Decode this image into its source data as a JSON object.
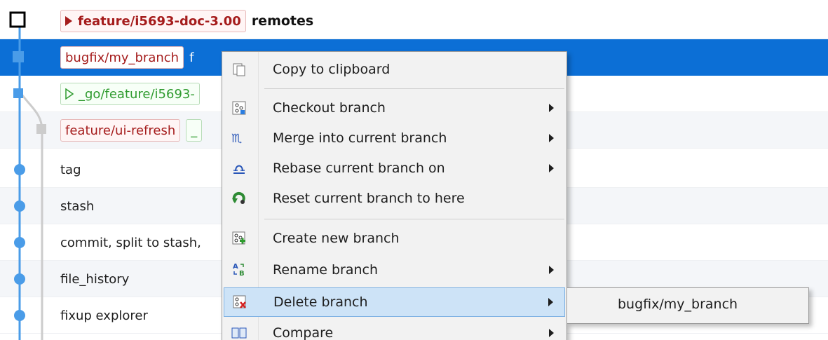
{
  "grid": {
    "rows": [
      {
        "badges": [
          {
            "text": "feature/i5693-doc-3.00",
            "style": "red-bold-arrow"
          }
        ],
        "subject": "remotes"
      },
      {
        "badges": [
          {
            "text": "bugfix/my_branch",
            "style": "red"
          }
        ],
        "subject": "f"
      },
      {
        "badges": [
          {
            "text": "_go/feature/i5693-",
            "style": "green-hollow-arrow"
          }
        ],
        "subject": ""
      },
      {
        "badges": [
          {
            "text": "feature/ui-refresh",
            "style": "red"
          },
          {
            "text": "_",
            "style": "green"
          }
        ],
        "subject": ""
      },
      {
        "subject": "tag"
      },
      {
        "subject": "stash"
      },
      {
        "subject": "commit, split to stash,"
      },
      {
        "subject": "file_history"
      },
      {
        "subject": "fixup explorer"
      }
    ]
  },
  "context_menu": {
    "items": [
      {
        "label": "Copy to clipboard",
        "icon": "clipboard-icon",
        "submenu": false
      },
      {
        "label": "Checkout branch",
        "icon": "checkout-branch-icon",
        "submenu": true
      },
      {
        "label": "Merge into current branch",
        "icon": "merge-icon",
        "submenu": true
      },
      {
        "label": "Rebase current branch on",
        "icon": "rebase-icon",
        "submenu": true
      },
      {
        "label": "Reset current branch to here",
        "icon": "reset-icon",
        "submenu": false
      },
      {
        "label": "Create new branch",
        "icon": "create-branch-icon",
        "submenu": false
      },
      {
        "label": "Rename branch",
        "icon": "rename-branch-icon",
        "submenu": true
      },
      {
        "label": "Delete branch",
        "icon": "delete-branch-icon",
        "submenu": true,
        "highlighted": true
      },
      {
        "label": "Compare",
        "icon": "compare-icon",
        "submenu": true
      }
    ]
  },
  "delete_submenu": {
    "items": [
      {
        "label": "bugfix/my_branch"
      }
    ]
  },
  "colors": {
    "selection": "#0c6fd6",
    "graph_line": "#4a9ce8",
    "menu_highlight": "#cde3f7",
    "branch_badge_text": "#a51c1c",
    "remote_badge_text": "#2f9b2f"
  }
}
